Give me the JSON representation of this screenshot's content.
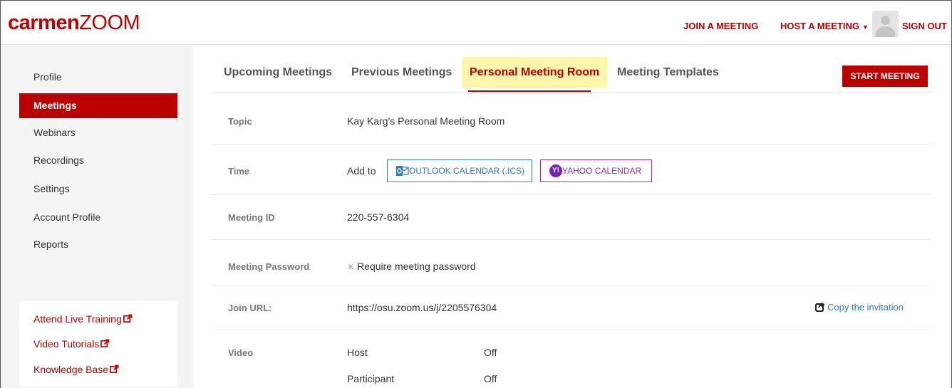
{
  "header": {
    "logo_bold": "carmen",
    "logo_light": "ZOOM",
    "join_label": "JOIN A MEETING",
    "host_label": "HOST A MEETING",
    "signout_label": "SIGN OUT"
  },
  "sidebar": {
    "items": [
      {
        "label": "Profile"
      },
      {
        "label": "Meetings",
        "active": true
      },
      {
        "label": "Webinars"
      },
      {
        "label": "Recordings"
      },
      {
        "label": "Settings"
      },
      {
        "label": "Account Profile"
      },
      {
        "label": "Reports"
      }
    ],
    "help_links": [
      {
        "label": "Attend Live Training"
      },
      {
        "label": "Video Tutorials"
      },
      {
        "label": "Knowledge Base"
      }
    ]
  },
  "tabs": [
    {
      "label": "Upcoming Meetings"
    },
    {
      "label": "Previous Meetings"
    },
    {
      "label": "Personal Meeting Room",
      "active": true
    },
    {
      "label": "Meeting Templates"
    }
  ],
  "start_meeting_label": "START MEETING",
  "details": {
    "topic": {
      "label": "Topic",
      "value": "Kay Karg's Personal Meeting Room"
    },
    "time": {
      "label": "Time",
      "add_to": "Add to",
      "outlook_label": "OUTLOOK CALENDAR (.ICS)",
      "yahoo_label": "YAHOO CALENDAR"
    },
    "meeting_id": {
      "label": "Meeting ID",
      "value": "220-557-6304"
    },
    "password": {
      "label": "Meeting Password",
      "value": "Require meeting password"
    },
    "join_url": {
      "label": "Join URL:",
      "value": "https://osu.zoom.us/j/2205576304",
      "copy_label": "Copy the invitation"
    },
    "video": {
      "label": "Video",
      "host_label": "Host",
      "host_value": "Off",
      "participant_label": "Participant",
      "participant_value": "Off"
    }
  },
  "colors": {
    "brand_red": "#bb0000",
    "tab_highlight": "#fff6ad",
    "link_blue": "#2e7bc4",
    "yahoo_purple": "#8e2fc2"
  }
}
